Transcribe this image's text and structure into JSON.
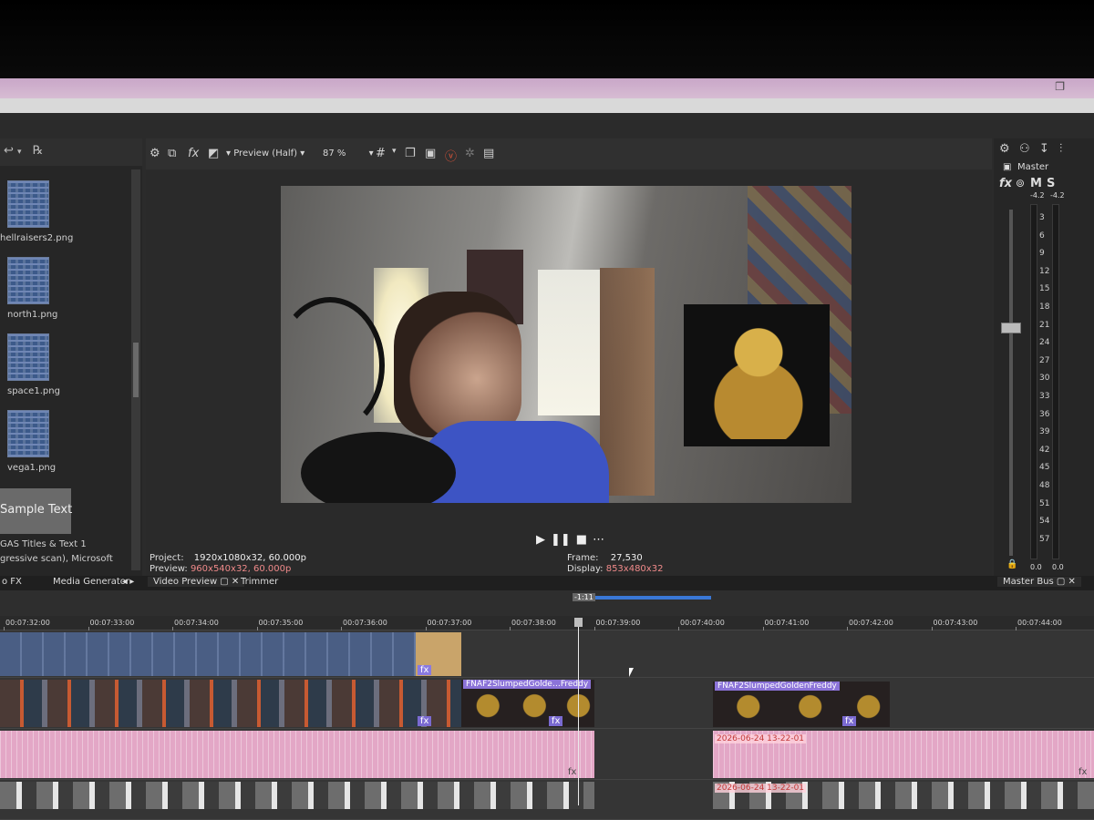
{
  "explorer": {
    "items": [
      {
        "label": "hellraisers2.png"
      },
      {
        "label": "north1.png"
      },
      {
        "label": "space1.png"
      },
      {
        "label": "vega1.png"
      },
      {
        "label": "GAS Titles & Text 1",
        "thumb_text": "Sample Text"
      }
    ],
    "status": "gressive scan), Microsoft"
  },
  "preview": {
    "mode_label": "Preview (Half)",
    "zoom": "87 %",
    "project_label": "Project:",
    "project_value": "1920x1080x32, 60.000p",
    "preview_label": "Preview:",
    "preview_value": "960x540x32, 60.000p",
    "frame_label": "Frame:",
    "frame_value": "27,530",
    "display_label": "Display:",
    "display_value": "853x480x32"
  },
  "master": {
    "title": "Master",
    "fx": "fx",
    "m": "M",
    "s": "S",
    "peak_left": "-4.2",
    "peak_right": "-4.2",
    "scale": [
      "3",
      "6",
      "9",
      "12",
      "15",
      "18",
      "21",
      "24",
      "27",
      "30",
      "33",
      "36",
      "39",
      "42",
      "45",
      "48",
      "51",
      "54",
      "57"
    ],
    "bottom_left": "0.0",
    "bottom_right": "0.0"
  },
  "tabs": {
    "fx": "o FX",
    "media_generator": "Media Generator",
    "video_preview": "Video Preview",
    "trimmer": "Trimmer",
    "master_bus": "Master Bus"
  },
  "timeline": {
    "loop_label": "-1:11",
    "ruler": [
      "00:07:32:00",
      "00:07:33:00",
      "00:07:34:00",
      "00:07:35:00",
      "00:07:36:00",
      "00:07:37:00",
      "00:07:38:00",
      "00:07:39:00",
      "00:07:40:00",
      "00:07:41:00",
      "00:07:42:00",
      "00:07:43:00",
      "00:07:44:00"
    ],
    "clips": {
      "freddy_a": "FNAF2SlumpedGolde…Freddy",
      "freddy_b": "FNAF2SlumpedGoldenFreddy",
      "audio_ts": "2026-06-24 13-22-01",
      "cam_ts": "2026-06-24 13-22-01"
    },
    "fx": "fx"
  },
  "colors": {
    "accent": "#3a78d6",
    "clip_purple": "#8b73d8",
    "audio_pink": "#e3a7c6",
    "titlebar_pink": "#d7bcd3"
  }
}
